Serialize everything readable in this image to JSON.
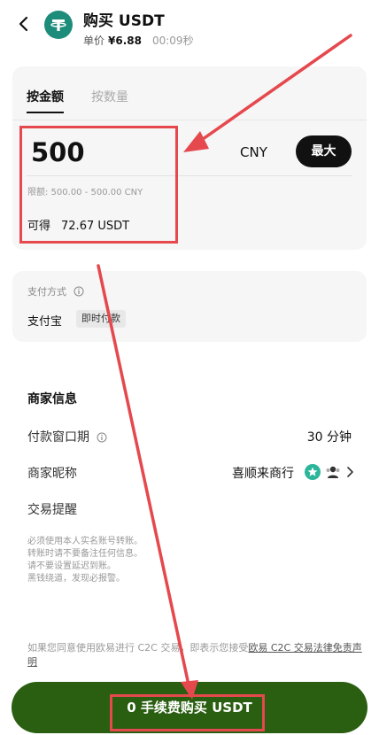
{
  "header": {
    "title": "购买 USDT",
    "price_label": "单价",
    "price_value": "¥6.88",
    "timer": "00:09秒"
  },
  "amount_card": {
    "tabs": [
      {
        "label": "按金额",
        "active": true
      },
      {
        "label": "按数量",
        "active": false
      }
    ],
    "amount_value": "500",
    "currency": "CNY",
    "max_label": "最大",
    "limit_text": "限额: 500.00 - 500.00 CNY",
    "receive_label": "可得",
    "receive_value": "72.67 USDT"
  },
  "payment_card": {
    "label": "支付方式",
    "method": "支付宝",
    "badge": "即时付款"
  },
  "merchant": {
    "title": "商家信息",
    "rows": [
      {
        "label": "付款窗口期",
        "value": "30 分钟"
      },
      {
        "label": "商家昵称",
        "value": "喜顺来商行"
      },
      {
        "label": "交易提醒",
        "value": ""
      }
    ],
    "tips": [
      "必须使用本人实名账号转账。",
      "转账时请不要备注任何信息。",
      "请不要设置延迟到账。",
      "黑钱绕道，发现必报警。"
    ]
  },
  "footer": {
    "disclaimer_prefix": "如果您同意使用欧易进行 C2C 交易，即表示您接受",
    "disclaimer_link": "欧易 C2C 交易法律免责声明",
    "buy_button": "0 手续费购买 USDT"
  },
  "colors": {
    "accent": "#2a5e11",
    "card_bg": "#f6f6f6",
    "annotation": "#e5484d",
    "tether": "#1e8c7a"
  },
  "icons": [
    "chevron-left-icon",
    "tether-logo-icon",
    "info-icon",
    "verified-badge-icon",
    "user-badge-icon",
    "chevron-right-icon"
  ]
}
